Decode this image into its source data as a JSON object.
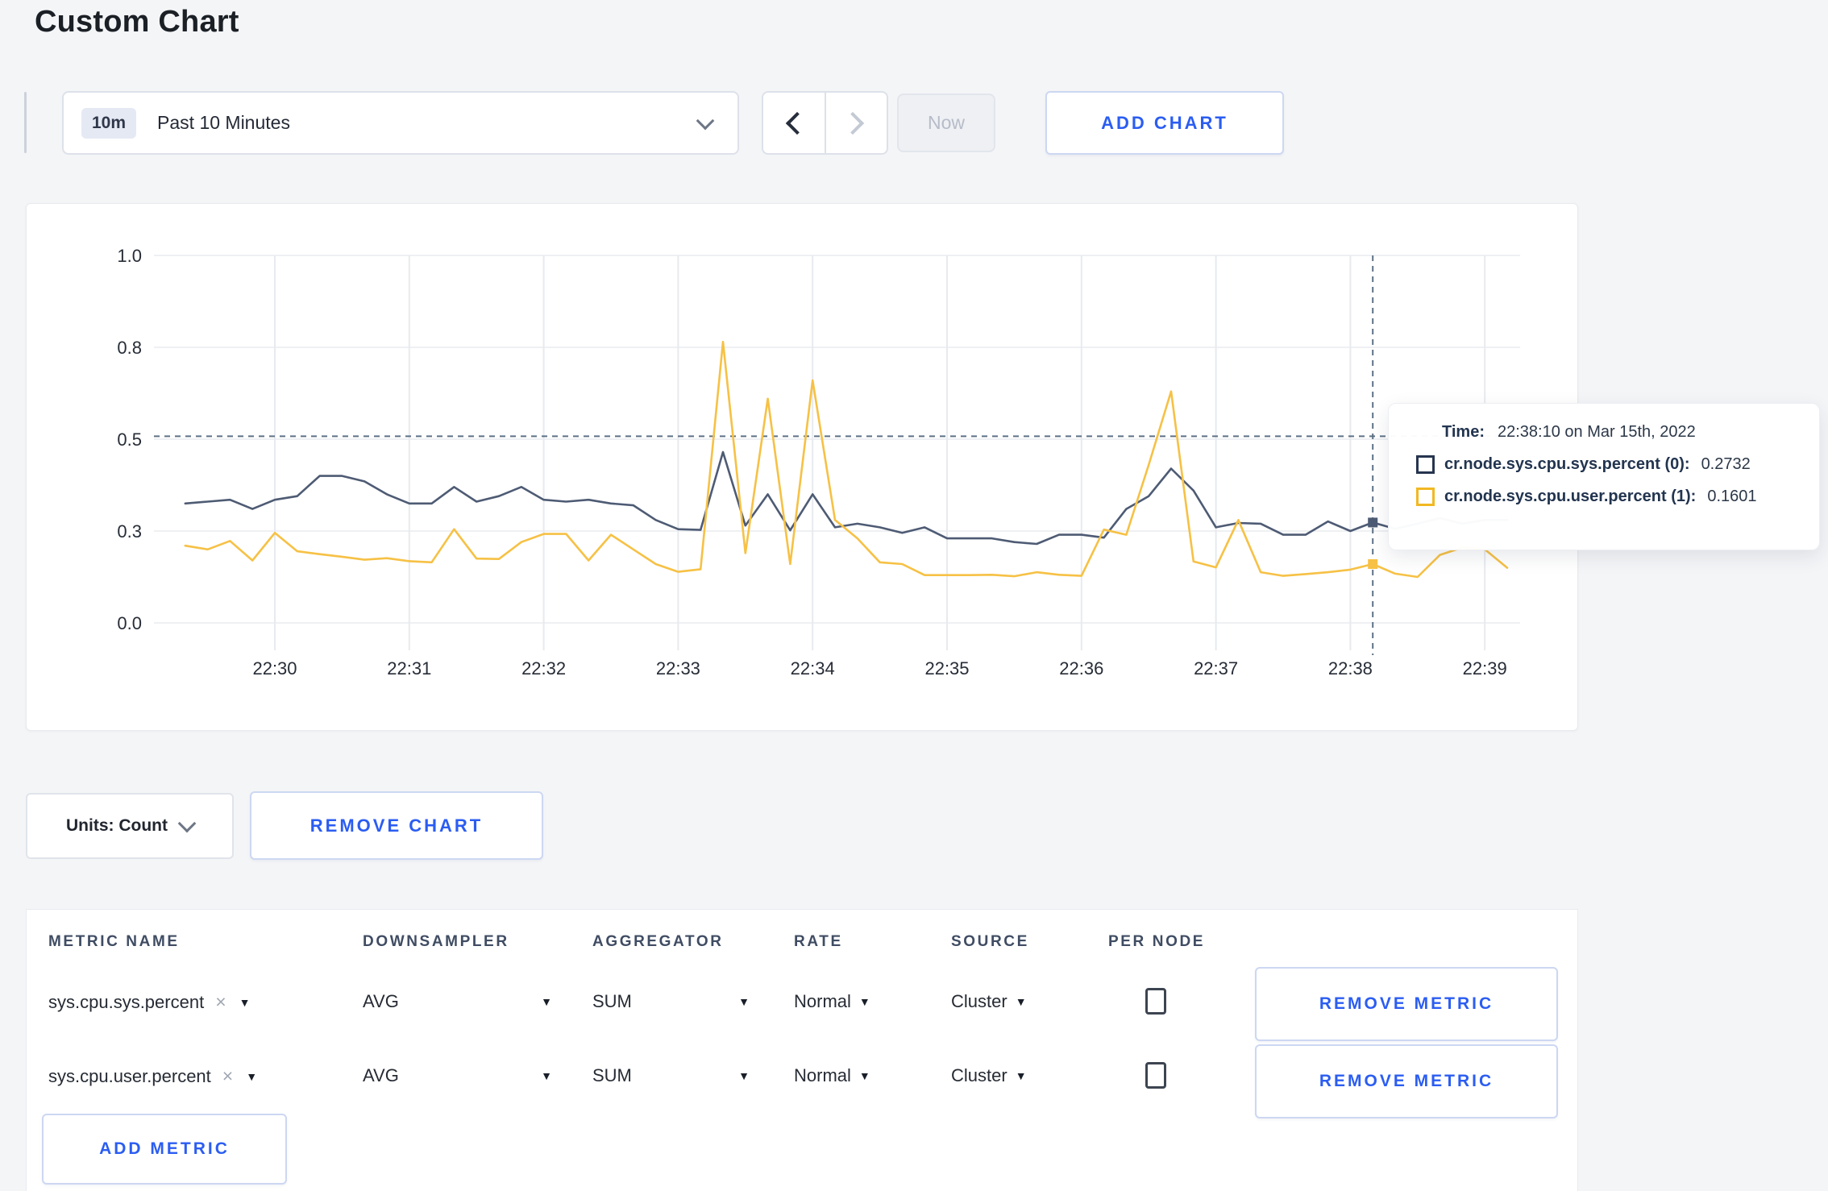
{
  "page": {
    "title": "Custom Chart"
  },
  "toolbar": {
    "time_range": {
      "badge": "10m",
      "label": "Past 10 Minutes"
    },
    "now_label": "Now",
    "add_chart_label": "ADD CHART"
  },
  "chart_card": {
    "tooltip": {
      "time_label": "Time:",
      "time_value": "22:38:10 on Mar 15th, 2022",
      "rows": [
        {
          "label": "cr.node.sys.cpu.sys.percent (0):",
          "value": "0.2732"
        },
        {
          "label": "cr.node.sys.cpu.user.percent (1):",
          "value": "0.1601"
        }
      ]
    }
  },
  "chart_data": {
    "type": "line",
    "title": "",
    "xlabel": "",
    "ylabel": "",
    "grid": true,
    "legend_position": "tooltip-overlay",
    "x_axis": {
      "tick_labels": [
        "22:30",
        "22:31",
        "22:32",
        "22:33",
        "22:34",
        "22:35",
        "22:36",
        "22:37",
        "22:38",
        "22:39"
      ],
      "start_time": "22:29:20",
      "interval_seconds": 10
    },
    "y_axis": {
      "range": [
        0,
        1
      ],
      "ticks": [
        {
          "label": "1.0",
          "value": 1.0
        },
        {
          "label": "0.8",
          "value": 0.75
        },
        {
          "label": "0.5",
          "value": 0.5
        },
        {
          "label": "0.3",
          "value": 0.25
        },
        {
          "label": "0.0",
          "value": 0.0
        }
      ]
    },
    "series": [
      {
        "name": "cr.node.sys.cpu.sys.percent (0)",
        "color": "#4e5b74",
        "values": [
          0.325,
          0.33,
          0.335,
          0.31,
          0.335,
          0.345,
          0.4,
          0.4,
          0.385,
          0.35,
          0.325,
          0.325,
          0.37,
          0.33,
          0.345,
          0.37,
          0.335,
          0.33,
          0.335,
          0.325,
          0.32,
          0.28,
          0.255,
          0.253,
          0.465,
          0.265,
          0.35,
          0.252,
          0.35,
          0.26,
          0.27,
          0.26,
          0.245,
          0.26,
          0.23,
          0.23,
          0.23,
          0.22,
          0.215,
          0.24,
          0.24,
          0.232,
          0.31,
          0.345,
          0.42,
          0.36,
          0.26,
          0.272,
          0.27,
          0.24,
          0.24,
          0.276,
          0.25,
          0.2732,
          0.256,
          0.27,
          0.285,
          0.27,
          0.28,
          0.28
        ]
      },
      {
        "name": "cr.node.sys.cpu.user.percent (1)",
        "color": "#f6c145",
        "values": [
          0.21,
          0.2,
          0.223,
          0.17,
          0.245,
          0.195,
          0.187,
          0.18,
          0.172,
          0.176,
          0.168,
          0.165,
          0.255,
          0.175,
          0.174,
          0.22,
          0.242,
          0.242,
          0.17,
          0.24,
          0.2,
          0.16,
          0.139,
          0.146,
          0.765,
          0.19,
          0.61,
          0.16,
          0.66,
          0.28,
          0.23,
          0.165,
          0.16,
          0.13,
          0.13,
          0.13,
          0.131,
          0.127,
          0.138,
          0.131,
          0.128,
          0.254,
          0.24,
          0.43,
          0.63,
          0.167,
          0.151,
          0.28,
          0.138,
          0.128,
          0.133,
          0.138,
          0.145,
          0.1601,
          0.134,
          0.125,
          0.185,
          0.205,
          0.2,
          0.15
        ]
      }
    ],
    "hover": {
      "time": "22:38:10",
      "seconds_from_start": 530,
      "crosshair_line_value": 0.508,
      "markers": [
        {
          "series": 0,
          "value": 0.2732
        },
        {
          "series": 1,
          "value": 0.1601
        }
      ]
    }
  },
  "controls": {
    "units_label": "Units: Count",
    "remove_chart_label": "REMOVE CHART"
  },
  "metrics_table": {
    "headers": [
      "METRIC NAME",
      "DOWNSAMPLER",
      "AGGREGATOR",
      "RATE",
      "SOURCE",
      "PER NODE"
    ],
    "rows": [
      {
        "metric": "sys.cpu.sys.percent",
        "downsampler": "AVG",
        "aggregator": "SUM",
        "rate": "Normal",
        "source": "Cluster",
        "per_node_checked": false,
        "remove_label": "REMOVE METRIC"
      },
      {
        "metric": "sys.cpu.user.percent",
        "downsampler": "AVG",
        "aggregator": "SUM",
        "rate": "Normal",
        "source": "Cluster",
        "per_node_checked": false,
        "remove_label": "REMOVE METRIC"
      }
    ],
    "add_metric_label": "ADD METRIC"
  }
}
